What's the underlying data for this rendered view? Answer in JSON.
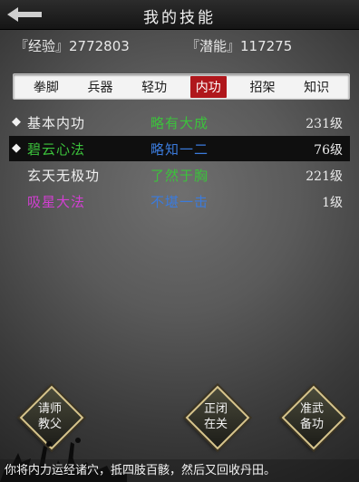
{
  "header": {
    "title": "我的技能"
  },
  "stats": {
    "experience": "『经验』2772803",
    "potential": "『潜能』117275"
  },
  "tabs": [
    {
      "label": "拳脚"
    },
    {
      "label": "兵器"
    },
    {
      "label": "轻功"
    },
    {
      "label": "内功"
    },
    {
      "label": "招架"
    },
    {
      "label": "知识"
    }
  ],
  "active_tab": "内功",
  "skills": [
    {
      "marker": "◆",
      "name": "基本内功",
      "tier": "略有大成",
      "level": "231级",
      "name_color": "#eeeeee",
      "tier_color": "#3cc23c"
    },
    {
      "marker": "◆",
      "name": "碧云心法",
      "tier": "略知一二",
      "level": "76级",
      "name_color": "#3cc23c",
      "tier_color": "#3b7bdc"
    },
    {
      "marker": "",
      "name": "玄天无极功",
      "tier": "了然于胸",
      "level": "221级",
      "name_color": "#eeeeee",
      "tier_color": "#3cc23c"
    },
    {
      "marker": "",
      "name": "吸星大法",
      "tier": "不堪一击",
      "level": "1级",
      "name_color": "#d23fd2",
      "tier_color": "#3b7bdc"
    }
  ],
  "buttons": {
    "teacher": "请师教父",
    "close": "正闭在关",
    "equip": "准武备功"
  },
  "message": "你将内力运经诸穴，抵四肢百骸，然后又回收丹田。",
  "colors": {
    "active_tab": "#b0171c",
    "diamond_border": "#d6c48c",
    "selected_row": "#0f0f0f"
  }
}
